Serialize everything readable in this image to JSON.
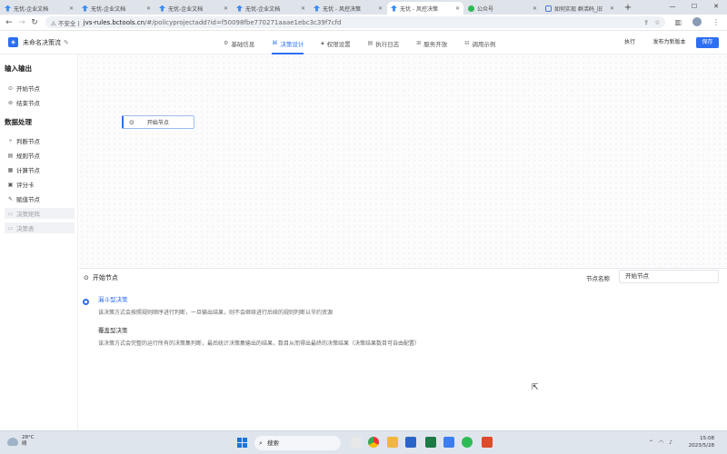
{
  "browser": {
    "tabs": [
      {
        "title": "无忧-企业文档",
        "favicon": "doc-icon"
      },
      {
        "title": "无忧-企业文档",
        "favicon": "doc-icon"
      },
      {
        "title": "无忧-企业文档",
        "favicon": "doc-icon"
      },
      {
        "title": "无忧-企业文档",
        "favicon": "doc-icon"
      },
      {
        "title": "无忧 - 风控决策",
        "favicon": "doc-icon"
      },
      {
        "title": "无忧 - 风控决策",
        "favicon": "doc-icon",
        "active": true
      },
      {
        "title": "公众号",
        "favicon": "wechat-icon"
      },
      {
        "title": "如何实现 群活码_旧",
        "favicon": "blog-icon"
      }
    ],
    "security_label": "不安全",
    "url_domain": "jvs-rules.bctools.cn",
    "url_path": "/#/policyprojectadd?id=f50098fbe770271aaae1ebc3c39f7cfd"
  },
  "app": {
    "project_name": "未命名决策流",
    "nav_tabs": [
      {
        "label": "基础信息",
        "icon": "gear-icon"
      },
      {
        "label": "决策设计",
        "icon": "design-icon",
        "active": true
      },
      {
        "label": "权限设置",
        "icon": "lock-icon"
      },
      {
        "label": "执行日志",
        "icon": "log-icon"
      },
      {
        "label": "服务开放",
        "icon": "service-icon"
      },
      {
        "label": "调用示例",
        "icon": "example-icon"
      }
    ],
    "actions": {
      "execute": "执行",
      "publish": "发布为新版本",
      "save": "保存"
    },
    "accent_color": "#2d6ff0"
  },
  "left_panel": {
    "io_section": {
      "title": "输入输出",
      "items": [
        {
          "label": "开始节点",
          "icon": "start-icon"
        },
        {
          "label": "结束节点",
          "icon": "end-icon"
        }
      ]
    },
    "data_section": {
      "title": "数据处理",
      "items": [
        {
          "label": "判断节点",
          "icon": "branch-icon"
        },
        {
          "label": "规则节点",
          "icon": "rule-icon"
        },
        {
          "label": "计算节点",
          "icon": "calc-icon"
        },
        {
          "label": "评分卡",
          "icon": "scorecard-icon"
        },
        {
          "label": "赋值节点",
          "icon": "assign-icon"
        },
        {
          "label": "决策矩阵",
          "icon": "matrix-icon",
          "disabled": true
        },
        {
          "label": "决策表",
          "icon": "table-icon",
          "disabled": true
        }
      ]
    }
  },
  "canvas": {
    "start_node_label": "开始节点"
  },
  "config_panel": {
    "title": "开始节点",
    "node_name_label": "节点名称",
    "node_name_value": "开始节点",
    "options": [
      {
        "title": "漏斗型决策",
        "desc": "该决策方式会按照规则顺序进行判断，一旦输出结果，则不会继续进行后续的规则判断以节约资源",
        "selected": true
      },
      {
        "title": "覆盖型决策",
        "desc": "该决策方式会完整的运行所有的决策集判断，最后统计决策集输出的结果，数目从而得出最终的决策结果（决策结果数目可自由配置）",
        "selected": false
      }
    ]
  },
  "taskbar": {
    "temperature": "28°C",
    "weather": "晴",
    "search_label": "搜索",
    "time": "15:08",
    "date": "2023/5/28"
  }
}
